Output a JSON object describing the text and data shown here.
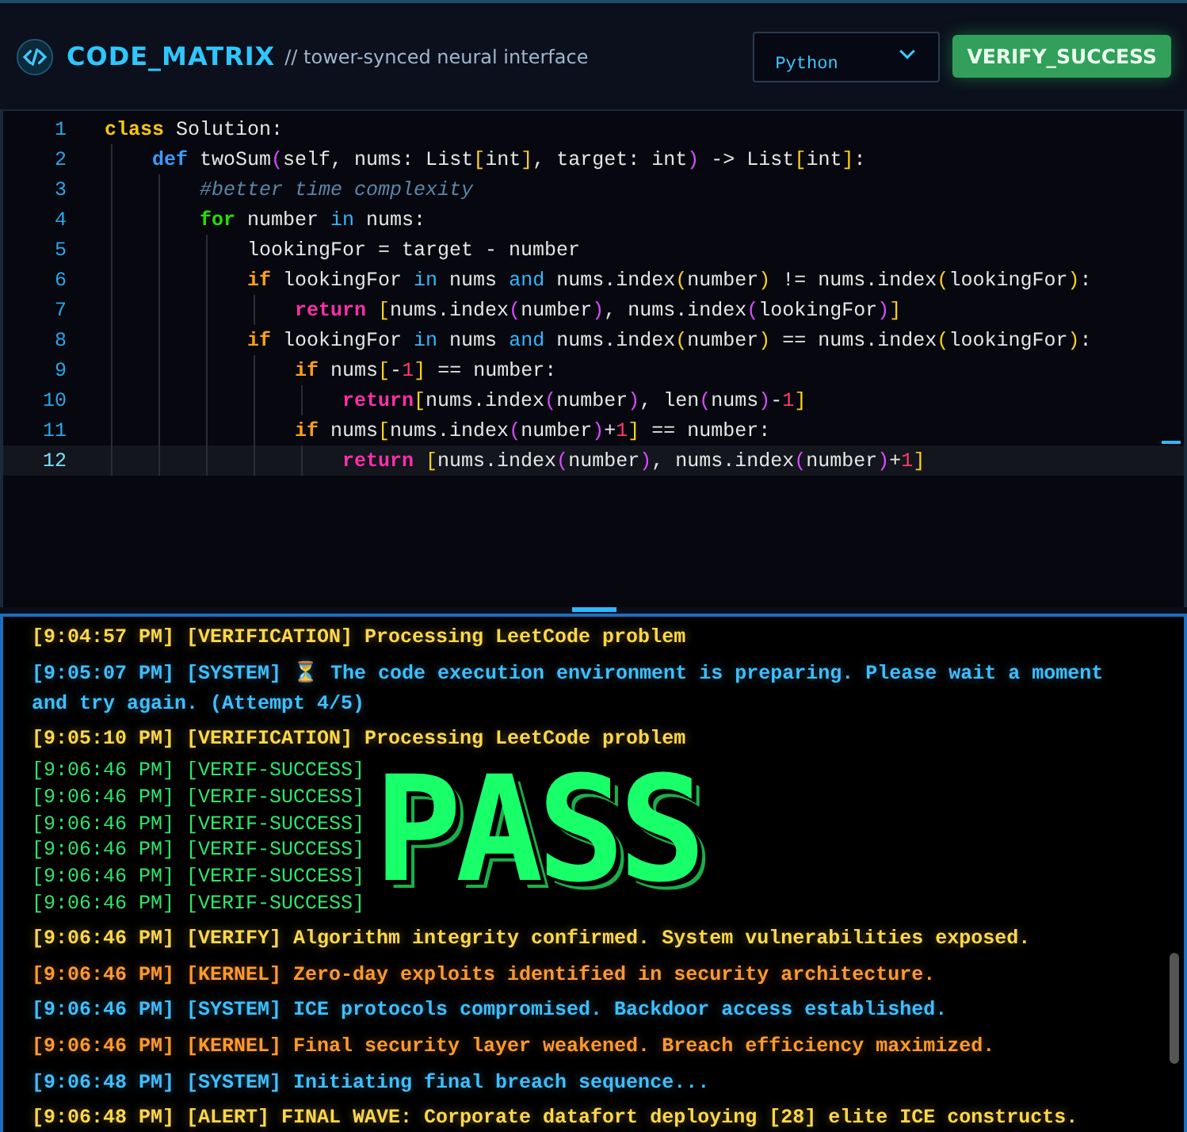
{
  "header": {
    "title": "CODE_MATRIX",
    "subtitle": "// tower-synced neural interface",
    "language": {
      "value": "Python"
    },
    "verify_button": "VERIFY_SUCCESS"
  },
  "editor": {
    "lines": [
      {
        "number": "1",
        "active": false,
        "tokens": [
          {
            "kind": "keyword",
            "text": "class"
          },
          {
            "kind": "plain",
            "text": " Solution:"
          }
        ],
        "children": [
          {
            "number": "2",
            "active": false,
            "tokens": [
              {
                "kind": "def",
                "text": "def"
              },
              {
                "kind": "plain",
                "text": " twoSum"
              },
              {
                "kind": "paren",
                "text": "("
              },
              {
                "kind": "plain",
                "text": "self, nums: List"
              },
              {
                "kind": "bracket",
                "text": "["
              },
              {
                "kind": "plain",
                "text": "int"
              },
              {
                "kind": "bracket",
                "text": "]"
              },
              {
                "kind": "plain",
                "text": ", target: int"
              },
              {
                "kind": "paren",
                "text": ")"
              },
              {
                "kind": "plain",
                "text": " -> List"
              },
              {
                "kind": "bracket",
                "text": "["
              },
              {
                "kind": "plain",
                "text": "int"
              },
              {
                "kind": "bracket",
                "text": "]"
              },
              {
                "kind": "plain",
                "text": ":"
              }
            ],
            "children": [
              {
                "number": "3",
                "active": false,
                "tokens": [
                  {
                    "kind": "comment",
                    "text": "#better time complexity"
                  }
                ]
              },
              {
                "number": "4",
                "active": false,
                "tokens": [
                  {
                    "kind": "loop",
                    "text": "for"
                  },
                  {
                    "kind": "plain",
                    "text": " number "
                  },
                  {
                    "kind": "op",
                    "text": "in"
                  },
                  {
                    "kind": "plain",
                    "text": " nums:"
                  }
                ],
                "children": [
                  {
                    "number": "5",
                    "active": false,
                    "tokens": [
                      {
                        "kind": "plain",
                        "text": "lookingFor = target - number"
                      }
                    ]
                  },
                  {
                    "number": "6",
                    "active": false,
                    "tokens": [
                      {
                        "kind": "cond",
                        "text": "if"
                      },
                      {
                        "kind": "plain",
                        "text": " lookingFor "
                      },
                      {
                        "kind": "op",
                        "text": "in"
                      },
                      {
                        "kind": "plain",
                        "text": " nums "
                      },
                      {
                        "kind": "op",
                        "text": "and"
                      },
                      {
                        "kind": "plain",
                        "text": " nums.index"
                      },
                      {
                        "kind": "bracket",
                        "text": "("
                      },
                      {
                        "kind": "plain",
                        "text": "number"
                      },
                      {
                        "kind": "bracket",
                        "text": ")"
                      },
                      {
                        "kind": "plain",
                        "text": " != nums.index"
                      },
                      {
                        "kind": "bracket",
                        "text": "("
                      },
                      {
                        "kind": "plain",
                        "text": "lookingFor"
                      },
                      {
                        "kind": "bracket",
                        "text": ")"
                      },
                      {
                        "kind": "plain",
                        "text": ":"
                      }
                    ],
                    "children": [
                      {
                        "number": "7",
                        "active": false,
                        "tokens": [
                          {
                            "kind": "return",
                            "text": "return "
                          },
                          {
                            "kind": "bracket",
                            "text": "["
                          },
                          {
                            "kind": "plain",
                            "text": "nums.index"
                          },
                          {
                            "kind": "paren",
                            "text": "("
                          },
                          {
                            "kind": "plain",
                            "text": "number"
                          },
                          {
                            "kind": "paren",
                            "text": ")"
                          },
                          {
                            "kind": "plain",
                            "text": ", nums.index"
                          },
                          {
                            "kind": "paren",
                            "text": "("
                          },
                          {
                            "kind": "plain",
                            "text": "lookingFor"
                          },
                          {
                            "kind": "paren",
                            "text": ")"
                          },
                          {
                            "kind": "bracket",
                            "text": "]"
                          }
                        ]
                      }
                    ]
                  },
                  {
                    "number": "8",
                    "active": false,
                    "tokens": [
                      {
                        "kind": "cond",
                        "text": "if"
                      },
                      {
                        "kind": "plain",
                        "text": " lookingFor "
                      },
                      {
                        "kind": "op",
                        "text": "in"
                      },
                      {
                        "kind": "plain",
                        "text": " nums "
                      },
                      {
                        "kind": "op",
                        "text": "and"
                      },
                      {
                        "kind": "plain",
                        "text": " nums.index"
                      },
                      {
                        "kind": "bracket",
                        "text": "("
                      },
                      {
                        "kind": "plain",
                        "text": "number"
                      },
                      {
                        "kind": "bracket",
                        "text": ")"
                      },
                      {
                        "kind": "plain",
                        "text": " == nums.index"
                      },
                      {
                        "kind": "bracket",
                        "text": "("
                      },
                      {
                        "kind": "plain",
                        "text": "lookingFor"
                      },
                      {
                        "kind": "bracket",
                        "text": ")"
                      },
                      {
                        "kind": "plain",
                        "text": ":"
                      }
                    ],
                    "children": [
                      {
                        "number": "9",
                        "active": false,
                        "tokens": [
                          {
                            "kind": "cond",
                            "text": "if"
                          },
                          {
                            "kind": "plain",
                            "text": " nums"
                          },
                          {
                            "kind": "bracket",
                            "text": "["
                          },
                          {
                            "kind": "plain",
                            "text": "-"
                          },
                          {
                            "kind": "number",
                            "text": "1"
                          },
                          {
                            "kind": "bracket",
                            "text": "]"
                          },
                          {
                            "kind": "plain",
                            "text": " == number:"
                          }
                        ],
                        "children": [
                          {
                            "number": "10",
                            "active": false,
                            "tokens": [
                              {
                                "kind": "return",
                                "text": "return"
                              },
                              {
                                "kind": "bracket",
                                "text": "["
                              },
                              {
                                "kind": "plain",
                                "text": "nums.index"
                              },
                              {
                                "kind": "paren",
                                "text": "("
                              },
                              {
                                "kind": "plain",
                                "text": "number"
                              },
                              {
                                "kind": "paren",
                                "text": ")"
                              },
                              {
                                "kind": "plain",
                                "text": ", len"
                              },
                              {
                                "kind": "paren",
                                "text": "("
                              },
                              {
                                "kind": "plain",
                                "text": "nums"
                              },
                              {
                                "kind": "paren",
                                "text": ")"
                              },
                              {
                                "kind": "plain",
                                "text": "-"
                              },
                              {
                                "kind": "number",
                                "text": "1"
                              },
                              {
                                "kind": "bracket",
                                "text": "]"
                              }
                            ]
                          }
                        ]
                      },
                      {
                        "number": "11",
                        "active": false,
                        "tokens": [
                          {
                            "kind": "cond",
                            "text": "if"
                          },
                          {
                            "kind": "plain",
                            "text": " nums"
                          },
                          {
                            "kind": "bracket",
                            "text": "["
                          },
                          {
                            "kind": "plain",
                            "text": "nums.index"
                          },
                          {
                            "kind": "paren",
                            "text": "("
                          },
                          {
                            "kind": "plain",
                            "text": "number"
                          },
                          {
                            "kind": "paren",
                            "text": ")"
                          },
                          {
                            "kind": "plain",
                            "text": "+"
                          },
                          {
                            "kind": "number",
                            "text": "1"
                          },
                          {
                            "kind": "bracket",
                            "text": "]"
                          },
                          {
                            "kind": "plain",
                            "text": " == number:"
                          }
                        ],
                        "children": [
                          {
                            "number": "12",
                            "active": true,
                            "tokens": [
                              {
                                "kind": "return",
                                "text": "return "
                              },
                              {
                                "kind": "bracket",
                                "text": "["
                              },
                              {
                                "kind": "plain",
                                "text": "nums.index"
                              },
                              {
                                "kind": "paren",
                                "text": "("
                              },
                              {
                                "kind": "plain",
                                "text": "number"
                              },
                              {
                                "kind": "paren",
                                "text": ")"
                              },
                              {
                                "kind": "plain",
                                "text": ", nums.index"
                              },
                              {
                                "kind": "paren",
                                "text": "("
                              },
                              {
                                "kind": "plain",
                                "text": "number"
                              },
                              {
                                "kind": "paren",
                                "text": ")"
                              },
                              {
                                "kind": "plain",
                                "text": "+"
                              },
                              {
                                "kind": "number",
                                "text": "1"
                              },
                              {
                                "kind": "bracket",
                                "text": "]"
                              }
                            ]
                          }
                        ]
                      }
                    ]
                  }
                ]
              }
            ]
          }
        ]
      }
    ]
  },
  "console": {
    "entries": [
      {
        "kind": "verification",
        "text": "[9:04:57 PM] [VERIFICATION] Processing LeetCode problem"
      },
      {
        "kind": "system",
        "text": "[9:05:07 PM] [SYSTEM] ⏳ The code execution environment is preparing. Please wait a moment and try again. (Attempt 4/5)"
      },
      {
        "kind": "verification",
        "text": "[9:05:10 PM] [VERIFICATION] Processing LeetCode problem"
      },
      {
        "kind": "success_group",
        "banner": "PASS",
        "lines": [
          "[9:06:46 PM] [VERIF-SUCCESS]",
          "[9:06:46 PM] [VERIF-SUCCESS]",
          "[9:06:46 PM] [VERIF-SUCCESS]",
          "[9:06:46 PM] [VERIF-SUCCESS]",
          "[9:06:46 PM] [VERIF-SUCCESS]",
          "[9:06:46 PM] [VERIF-SUCCESS]"
        ]
      },
      {
        "kind": "verification",
        "text": "[9:06:46 PM] [VERIFY] Algorithm integrity confirmed. System vulnerabilities exposed."
      },
      {
        "kind": "kernel",
        "text": "[9:06:46 PM] [KERNEL] Zero-day exploits identified in security architecture."
      },
      {
        "kind": "system",
        "text": "[9:06:46 PM] [SYSTEM] ICE protocols compromised. Backdoor access established."
      },
      {
        "kind": "kernel",
        "text": "[9:06:46 PM] [KERNEL] Final security layer weakened. Breach efficiency maximized."
      },
      {
        "kind": "system",
        "text": "[9:06:48 PM] [SYSTEM] Initiating final breach sequence..."
      },
      {
        "kind": "alert",
        "text": "[9:06:48 PM] [ALERT] FINAL WAVE: Corporate datafort deploying [28] elite ICE constructs."
      }
    ]
  }
}
